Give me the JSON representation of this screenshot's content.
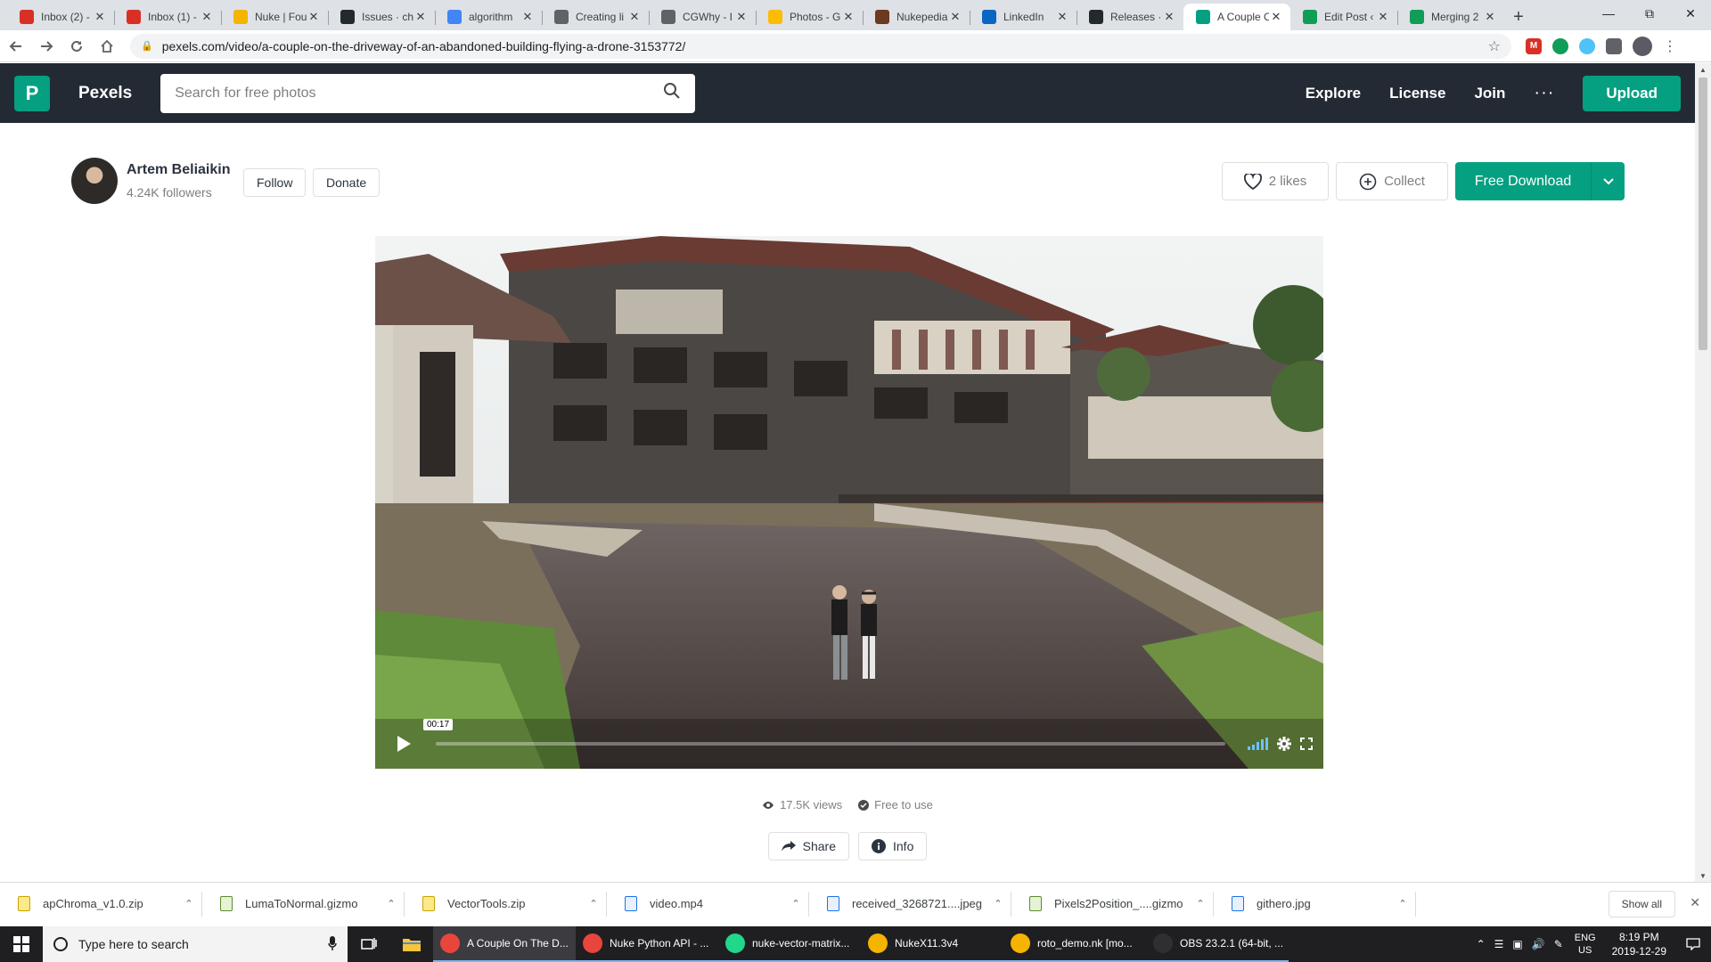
{
  "browser": {
    "tabs": [
      {
        "title": "Inbox (2) -",
        "favicon": "gmail-icon",
        "color": "#d93025"
      },
      {
        "title": "Inbox (1) -",
        "favicon": "gmail-icon",
        "color": "#d93025"
      },
      {
        "title": "Nuke | Fou",
        "favicon": "foundry-icon",
        "color": "#f5b400"
      },
      {
        "title": "Issues · ch",
        "favicon": "github-icon",
        "color": "#24292e"
      },
      {
        "title": "algorithm",
        "favicon": "algorithm-icon",
        "color": "#4285f4"
      },
      {
        "title": "Creating li",
        "favicon": "globe-icon",
        "color": "#5f6368"
      },
      {
        "title": "CGWhy - I",
        "favicon": "globe-icon",
        "color": "#5f6368"
      },
      {
        "title": "Photos - G",
        "favicon": "photos-icon",
        "color": "#fbbc05"
      },
      {
        "title": "Nukepedia",
        "favicon": "nukepedia-icon",
        "color": "#6b3a1f"
      },
      {
        "title": "LinkedIn",
        "favicon": "linkedin-icon",
        "color": "#0a66c2"
      },
      {
        "title": "Releases ·",
        "favicon": "github-icon",
        "color": "#24292e"
      },
      {
        "title": "A Couple O",
        "favicon": "pexels-icon",
        "color": "#05a081",
        "active": true
      },
      {
        "title": "Edit Post ‹",
        "favicon": "sheets-icon",
        "color": "#0f9d58"
      },
      {
        "title": "Merging 2",
        "favicon": "sheets-icon",
        "color": "#0f9d58"
      }
    ],
    "url": "pexels.com/video/a-couple-on-the-driveway-of-an-abandoned-building-flying-a-drone-3153772/"
  },
  "header": {
    "brand": "Pexels",
    "logo_letter": "P",
    "search_placeholder": "Search for free photos",
    "nav": [
      "Explore",
      "License",
      "Join"
    ],
    "more": "···",
    "upload": "Upload",
    "accent": "#05a081"
  },
  "author": {
    "name": "Artem Beliaikin",
    "followers": "4.24K followers",
    "follow": "Follow",
    "donate": "Donate"
  },
  "actions": {
    "likes": "2 likes",
    "collect": "Collect",
    "download": "Free Download"
  },
  "video": {
    "current_time": "00:17",
    "progress": 0
  },
  "meta": {
    "views": "17.5K views",
    "license": "Free to use",
    "share": "Share",
    "info": "Info"
  },
  "downloads": {
    "items": [
      {
        "name": "apChroma_v1.0.zip",
        "type": "zip"
      },
      {
        "name": "LumaToNormal.gizmo",
        "type": "gizmo"
      },
      {
        "name": "VectorTools.zip",
        "type": "zip"
      },
      {
        "name": "video.mp4",
        "type": "file"
      },
      {
        "name": "received_3268721....jpeg",
        "type": "file"
      },
      {
        "name": "Pixels2Position_....gizmo",
        "type": "gizmo"
      },
      {
        "name": "githero.jpg",
        "type": "file"
      }
    ],
    "show_all": "Show all"
  },
  "taskbar": {
    "search_placeholder": "Type here to search",
    "apps": [
      {
        "label": "A Couple On The D...",
        "color": "#e8453c",
        "active": true
      },
      {
        "label": "Nuke Python API - ...",
        "color": "#e8453c"
      },
      {
        "label": "nuke-vector-matrix...",
        "color": "#21d789"
      },
      {
        "label": "NukeX11.3v4",
        "color": "#f5b400"
      },
      {
        "label": "roto_demo.nk [mo...",
        "color": "#f5b400"
      },
      {
        "label": "OBS 23.2.1 (64-bit, ...",
        "color": "#302e31"
      }
    ],
    "lang_top": "ENG",
    "lang_bottom": "US",
    "time": "8:19 PM",
    "date": "2019-12-29"
  }
}
